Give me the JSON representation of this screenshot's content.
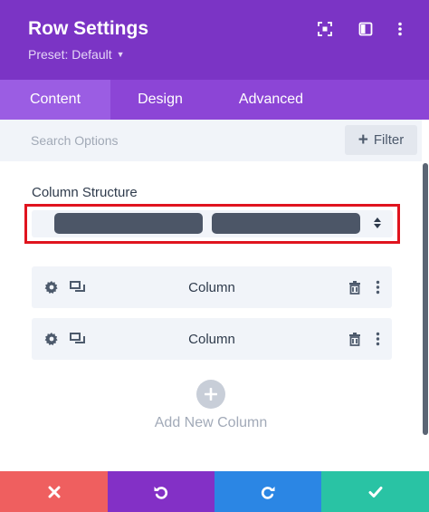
{
  "header": {
    "title": "Row Settings",
    "preset": "Preset: Default",
    "icons": [
      "focus-icon",
      "sidebar-toggle-icon",
      "more-vertical-icon"
    ]
  },
  "tabs": [
    {
      "label": "Content",
      "active": true
    },
    {
      "label": "Design",
      "active": false
    },
    {
      "label": "Advanced",
      "active": false
    }
  ],
  "search": {
    "placeholder": "Search Options",
    "filter_label": "Filter"
  },
  "column_structure": {
    "label": "Column Structure",
    "selected_columns": 2
  },
  "columns": [
    {
      "label": "Column"
    },
    {
      "label": "Column"
    }
  ],
  "add_column": {
    "label": "Add New Column"
  },
  "footer": {
    "buttons": [
      "close-icon",
      "undo-icon",
      "redo-icon",
      "check-icon"
    ]
  },
  "colors": {
    "header": "#7b34c5",
    "tabs": "#8c45d6",
    "active_tab": "#9b5de3",
    "cancel": "#ef5f5f",
    "undo": "#8330c6",
    "redo": "#2b86e4",
    "save": "#29c3a4",
    "highlight": "#e0141e"
  }
}
